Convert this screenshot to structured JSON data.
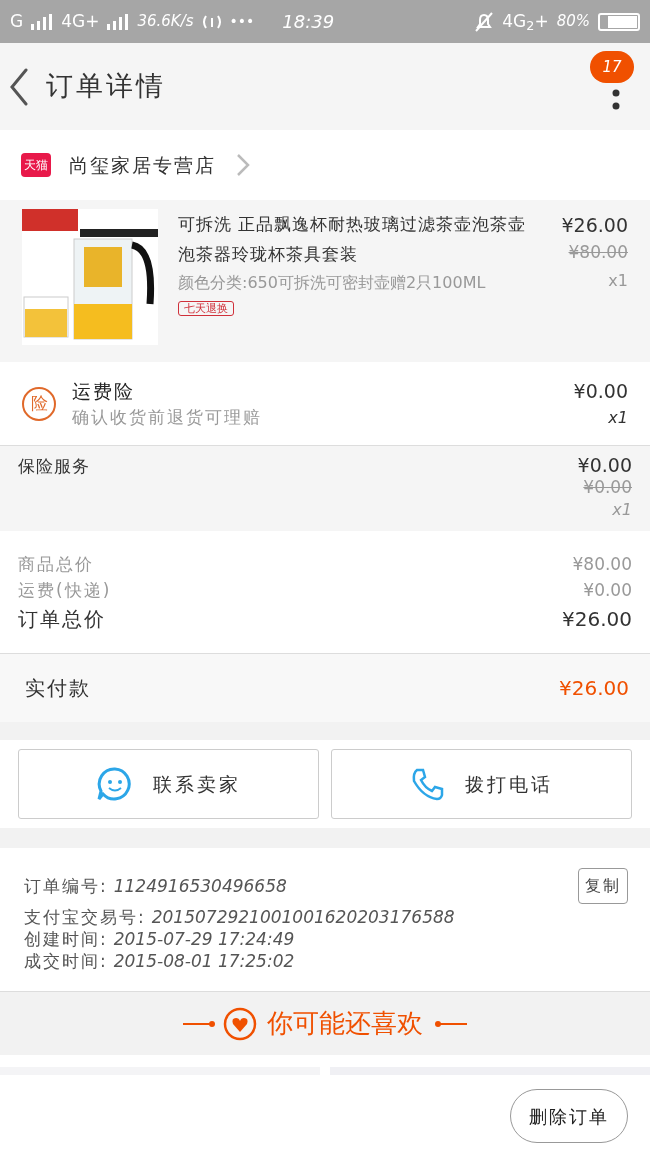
{
  "status_bar": {
    "carrier_1": "G",
    "network_2": "4G+",
    "speed": "36.6K/s",
    "dots": "•••",
    "time": "18:39",
    "network_right": "4G$_{2}$+",
    "battery": "80%"
  },
  "header": {
    "title": "订单详情",
    "badge": "17"
  },
  "store": {
    "logo": "天猫",
    "name": "尚玺家居专营店"
  },
  "product": {
    "title": "可拆洗  正品飘逸杯耐热玻璃过滤茶壶泡茶壶泡茶器玲珑杯茶具套装",
    "spec": "颜色分类:650可拆洗可密封壶赠2只100ML",
    "tag": "七天退换",
    "price": "¥26.00",
    "original_price": "¥80.00",
    "quantity": "x1"
  },
  "shipping_insurance": {
    "icon_text": "险",
    "title": "运费险",
    "subtitle": "确认收货前退货可理赔",
    "price": "¥0.00",
    "quantity": "x1"
  },
  "insurance_service": {
    "title": "保险服务",
    "price": "¥0.00",
    "original_price": "¥0.00",
    "quantity": "x1"
  },
  "totals": [
    {
      "label": "商品总价",
      "value": "¥80.00",
      "emphasis": false
    },
    {
      "label": "运费(快递)",
      "value": "¥0.00",
      "emphasis": false
    },
    {
      "label": "订单总价",
      "value": "¥26.00",
      "emphasis": true
    }
  ],
  "paid": {
    "label": "实付款",
    "value": "¥26.00"
  },
  "actions": [
    {
      "label": "联系卖家",
      "kind": "chat"
    },
    {
      "label": "拨打电话",
      "kind": "phone"
    }
  ],
  "order_info": {
    "copy_button": "复制",
    "lines": [
      {
        "label": "订单编号:",
        "value": "1124916530496658"
      },
      {
        "label": "支付宝交易号:",
        "value": "2015072921001001620203176588"
      },
      {
        "label": "创建时间:",
        "value": "2015-07-29 17:24:49"
      },
      {
        "label": "成交时间:",
        "value": "2015-08-01 17:25:02"
      }
    ]
  },
  "recommend": {
    "title": "你可能还喜欢"
  },
  "delete_button": "删除订单"
}
